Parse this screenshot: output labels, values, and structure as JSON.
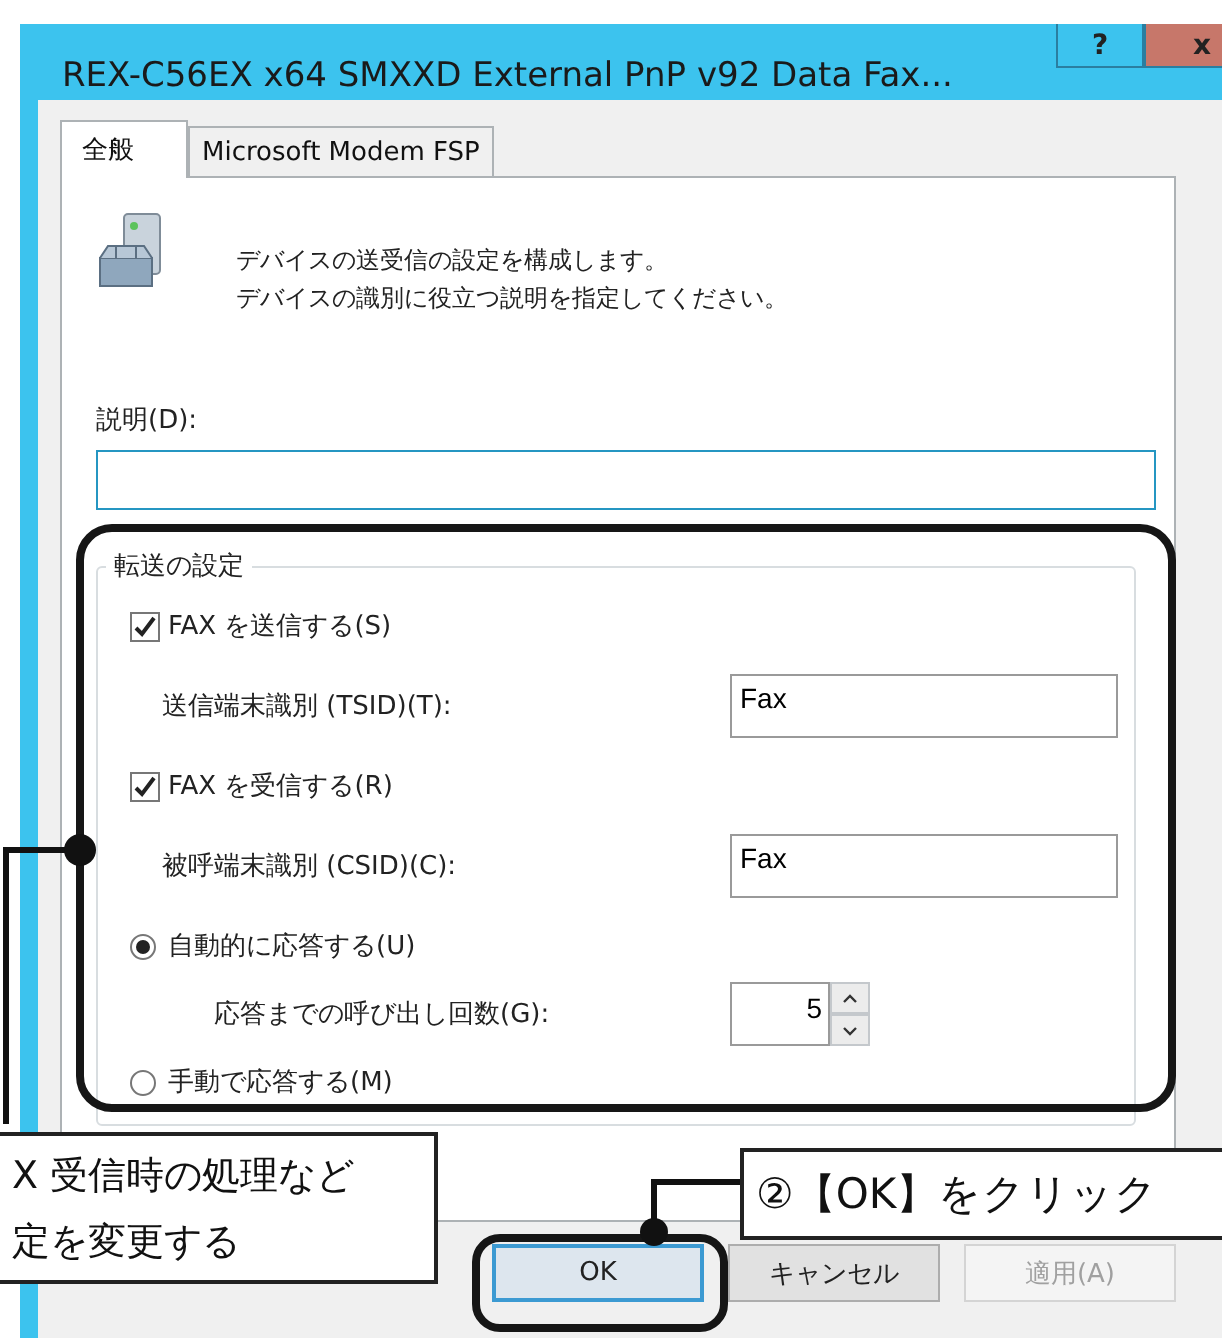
{
  "window": {
    "title": "REX-C56EX x64 SMXXD External PnP v92 Data Fax...",
    "help_button": "?",
    "close_button": "x"
  },
  "tabs": [
    {
      "label": "全般",
      "selected": true
    },
    {
      "label": "Microsoft Modem FSP",
      "selected": false
    }
  ],
  "intro": [
    "デバイスの送受信の設定を構成します。",
    "デバイスの識別に役立つ説明を指定してください。"
  ],
  "description": {
    "label": "説明(D):"
  },
  "transfer": {
    "title": "転送の設定",
    "items": [
      {
        "kind": "checkbox",
        "label": "FAX を送信する(S)",
        "checked": true
      },
      {
        "kind": "field",
        "label": "送信端末識別 (TSID)(T):",
        "value": "Fax"
      },
      {
        "kind": "checkbox",
        "label": "FAX を受信する(R)",
        "checked": true
      },
      {
        "kind": "field",
        "label": "被呼端末識別 (CSID)(C):",
        "value": "Fax"
      },
      {
        "kind": "radio",
        "label": "自動的に応答する(U)",
        "selected": true
      },
      {
        "kind": "spin",
        "label": "応答までの呼び出し回数(G):",
        "value": "5"
      },
      {
        "kind": "radio",
        "label": "手動で応答する(M)",
        "selected": false
      }
    ]
  },
  "buttons": [
    {
      "label": "OK",
      "disabled": false,
      "default": true
    },
    {
      "label": "キャンセル",
      "disabled": false,
      "default": false
    },
    {
      "label": "適用(A)",
      "disabled": true,
      "default": false
    }
  ],
  "annotations": [
    {
      "kind": "region",
      "lines": [
        "X 受信時の処理など",
        "定を変更する"
      ]
    },
    {
      "kind": "button",
      "lines": [
        "②【OK】をクリック"
      ]
    }
  ]
}
